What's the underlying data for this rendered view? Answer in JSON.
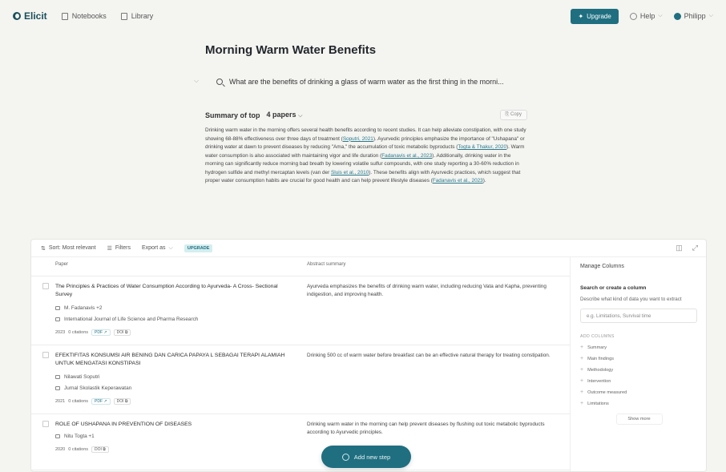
{
  "nav": {
    "logo": "Elicit",
    "notebooks": "Notebooks",
    "library": "Library",
    "upgrade": "Upgrade",
    "help": "Help",
    "user": "Philipp"
  },
  "page": {
    "title": "Morning Warm Water Benefits",
    "query": "What are the benefits of drinking a glass of warm water as the first thing in the morni..."
  },
  "summary": {
    "label": "Summary of top",
    "papers": "4 papers",
    "copy": "Copy",
    "p1": "Drinking warm water in the morning offers several health benefits according to recent studies. It can help alleviate constipation, with one study showing 68-88% effectiveness over three days of treatment (",
    "c1": "Soputri, 2021",
    "p2": "). Ayurvedic principles emphasize the importance of \"Ushapana\" or drinking water at dawn to prevent diseases by reducing \"Ama,\" the accumulation of toxic metabolic byproducts (",
    "c2": "Togta & Thakur, 2020",
    "p3": "). Warm water consumption is also associated with maintaining vigor and life duration (",
    "c3": "Fadanavis et al., 2023",
    "p4": "). Additionally, drinking water in the morning can significantly reduce morning bad breath by lowering volatile sulfur compounds, with one study reporting a 30-60% reduction in hydrogen sulfide and methyl mercaptan levels (van der ",
    "c4": "Sluis et al., 2010",
    "p5": "). These benefits align with Ayurvedic practices, which suggest that proper water consumption habits are crucial for good health and can help prevent lifestyle diseases (",
    "c5": "Fadanavis et al., 2023",
    "p6": ")."
  },
  "toolbar": {
    "sort": "Sort: Most relevant",
    "filters": "Filters",
    "export": "Export as",
    "upgrade_tag": "UPGRADE"
  },
  "table": {
    "col_paper": "Paper",
    "col_abstract": "Abstract summary",
    "rows": [
      {
        "title": "The Principles & Practices of Water Consumption According to Ayurveda- A Cross- Sectional Survey",
        "authors": "M. Fadanavis +2",
        "journal": "International Journal of Life Science and Pharma Research",
        "year": "2023",
        "citations": "0 citations",
        "pdf": "PDF",
        "doi": "DOI",
        "abstract": "Ayurveda emphasizes the benefits of drinking warm water, including reducing Vata and Kapha, preventing indigestion, and improving health."
      },
      {
        "title": "EFEKTIFITAS KONSUMSI AIR BENING DAN CARICA PAPAYA L SEBAGAI TERAPI ALAMIAH UNTUK MENGATASI KONSTIPASI",
        "authors": "Nilawati Soputri",
        "journal": "Jurnal Skolastik Keperawatan",
        "year": "2021",
        "citations": "0 citations",
        "pdf": "PDF",
        "doi": "DOI",
        "abstract": "Drinking 500 cc of warm water before breakfast can be an effective natural therapy for treating constipation."
      },
      {
        "title": "ROLE OF USHAPANA IN PREVENTION OF DISEASES",
        "authors": "Nitu Togta +1",
        "year": "2020",
        "citations": "0 citations",
        "doi": "DOI",
        "abstract": "Drinking warm water in the morning can help prevent diseases by flushing out toxic metabolic byproducts according to Ayurvedic principles."
      }
    ]
  },
  "manage": {
    "title": "Manage Columns",
    "search_title": "Search or create a column",
    "desc": "Describe what kind of data you want to extract",
    "placeholder": "e.g. Limitations, Survival time",
    "add_head": "ADD COLUMNS",
    "options": [
      "Summary",
      "Main findings",
      "Methodology",
      "Intervention",
      "Outcome measured",
      "Limitations"
    ],
    "show_more": "Show more"
  },
  "add_step": "Add new step"
}
